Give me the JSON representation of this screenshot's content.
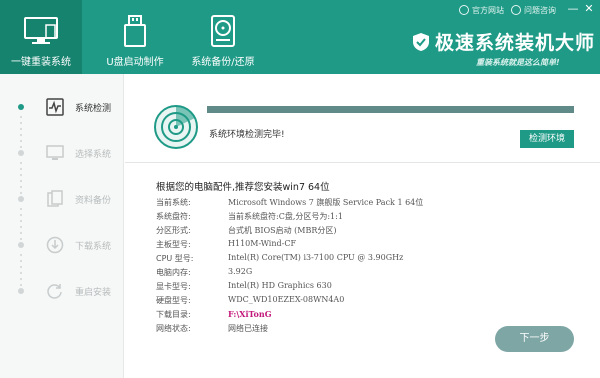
{
  "header": {
    "tabs": [
      {
        "label": "一键重装系统",
        "icon": "monitor-icon",
        "active": true
      },
      {
        "label": "U盘启动制作",
        "icon": "usb-icon",
        "active": false
      },
      {
        "label": "系统备份/还原",
        "icon": "disk-backup-icon",
        "active": false
      }
    ],
    "links": {
      "website": "官方网站",
      "help": "问题咨询"
    },
    "window_controls": {
      "minimize": "—",
      "close": "✕"
    },
    "brand": "极速系统装机大师",
    "slogan": "重装系统就是这么简单!"
  },
  "sidebar": {
    "steps": [
      {
        "label": "系统检测",
        "icon": "pulse-monitor-icon",
        "active": true
      },
      {
        "label": "选择系统",
        "icon": "select-system-icon",
        "active": false
      },
      {
        "label": "资料备份",
        "icon": "files-backup-icon",
        "active": false
      },
      {
        "label": "下载系统",
        "icon": "download-icon",
        "active": false
      },
      {
        "label": "重启安装",
        "icon": "restart-icon",
        "active": false
      }
    ]
  },
  "detection": {
    "progress": 1.0,
    "message": "系统环境检测完毕!",
    "button": "检测环境"
  },
  "recommendation": "根据您的电脑配件,推荐您安装win7 64位",
  "system_info": [
    {
      "key": "当前系统:",
      "value": "Microsoft Windows 7 旗舰版 Service Pack 1 64位"
    },
    {
      "key": "系统盘符:",
      "value": "当前系统盘符:C盘,分区号为:1:1"
    },
    {
      "key": "分区形式:",
      "value": "台式机 BIOS启动 (MBR分区)"
    },
    {
      "key": "主板型号:",
      "value": "H110M-Wind-CF"
    },
    {
      "key": "CPU 型号:",
      "value": "Intel(R) Core(TM) i3-7100 CPU @ 3.90GHz"
    },
    {
      "key": "电脑内存:",
      "value": "3.92G"
    },
    {
      "key": "显卡型号:",
      "value": "Intel(R) HD Graphics 630"
    },
    {
      "key": "硬盘型号:",
      "value": "WDC_WD10EZEX-08WN4A0"
    },
    {
      "key": "下载目录:",
      "value": "F:\\XiTonG",
      "link": true
    },
    {
      "key": "网络状态:",
      "value": "网络已连接"
    }
  ],
  "next_button": "下一步",
  "colors": {
    "accent": "#1e9a86",
    "accent_dark": "#16836f",
    "progress": "#5f8a87",
    "next": "#7ea6a5",
    "path": "#c2187a"
  }
}
